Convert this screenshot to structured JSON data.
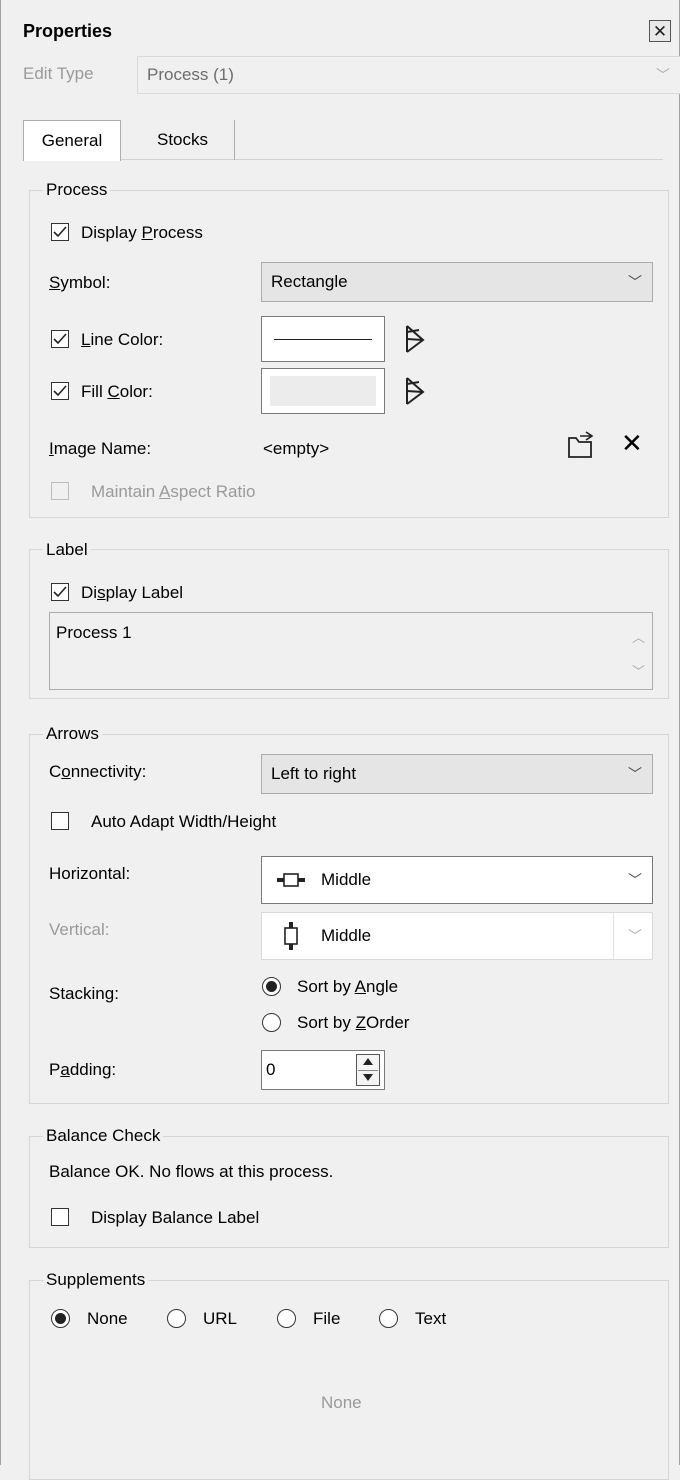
{
  "window": {
    "title": "Properties"
  },
  "edit_type": {
    "label": "Edit Type",
    "value": "Process (1)"
  },
  "tabs": [
    {
      "label": "General",
      "active": true
    },
    {
      "label": "Stocks",
      "active": false
    }
  ],
  "process": {
    "legend": "Process",
    "display_process": {
      "label": "Display Process",
      "checked": true
    },
    "symbol": {
      "label": "Symbol:",
      "value": "Rectangle"
    },
    "line_color": {
      "label": "Line Color:",
      "checked": true
    },
    "fill_color": {
      "label": "Fill Color:",
      "checked": true
    },
    "image_name": {
      "label": "Image Name:",
      "value": "<empty>"
    },
    "maintain_aspect": {
      "label": "Maintain Aspect Ratio",
      "checked": false,
      "disabled": true
    }
  },
  "label_group": {
    "legend": "Label",
    "display_label": {
      "label": "Display Label",
      "checked": true
    },
    "text": "Process 1"
  },
  "arrows": {
    "legend": "Arrows",
    "connectivity": {
      "label": "Connectivity:",
      "value": "Left to right"
    },
    "auto_adapt": {
      "label": "Auto Adapt Width/Height",
      "checked": false
    },
    "horizontal": {
      "label": "Horizontal:",
      "value": "Middle"
    },
    "vertical": {
      "label": "Vertical:",
      "value": "Middle"
    },
    "stacking": {
      "label": "Stacking:",
      "options": [
        "Sort by Angle",
        "Sort by ZOrder"
      ],
      "selected": "Sort by Angle"
    },
    "padding": {
      "label": "Padding:",
      "value": "0"
    }
  },
  "balance": {
    "legend": "Balance Check",
    "status": "Balance OK. No flows at this process.",
    "display_balance_label": {
      "label": "Display Balance Label",
      "checked": false
    }
  },
  "supplements": {
    "legend": "Supplements",
    "options": [
      "None",
      "URL",
      "File",
      "Text"
    ],
    "selected": "None",
    "placeholder": "None"
  }
}
